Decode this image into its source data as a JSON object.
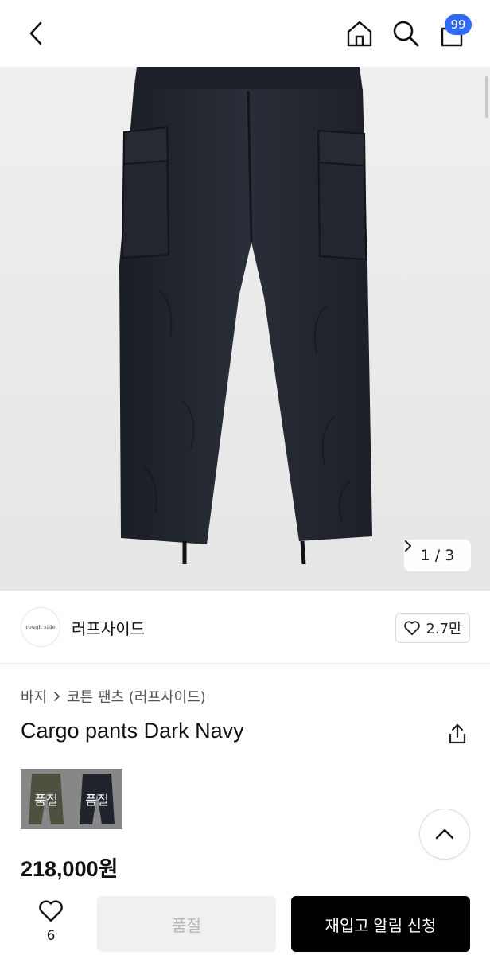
{
  "header": {
    "back_icon": "chevron-left-icon",
    "home_icon": "home-icon",
    "search_icon": "search-icon",
    "cart_icon": "shopping-bag-icon",
    "cart_badge": "99",
    "badge_color": "#2f6bf5"
  },
  "gallery": {
    "counter": "1 / 3",
    "next_icon": "chevron-right-icon",
    "image_subject": "dark navy cargo pants"
  },
  "brand": {
    "logo_text": "rough side",
    "name": "러프사이드",
    "like_count": "2.7만",
    "like_icon": "heart-outline-icon"
  },
  "breadcrumb": {
    "category": "바지",
    "separator_icon": "chevron-right-icon",
    "subcategory": "코튼 팬츠 (러프사이드)"
  },
  "product": {
    "title": "Cargo pants Dark Navy",
    "price": "218,000원",
    "share_icon": "share-icon"
  },
  "options": [
    {
      "label": "품절",
      "color": "olive"
    },
    {
      "label": "품절",
      "color": "dark-navy"
    }
  ],
  "scroll_top_icon": "chevron-up-icon",
  "bottom_bar": {
    "wish_icon": "heart-outline-icon",
    "wish_count": "6",
    "soldout_label": "품절",
    "restock_label": "재입고 알림 신청"
  }
}
